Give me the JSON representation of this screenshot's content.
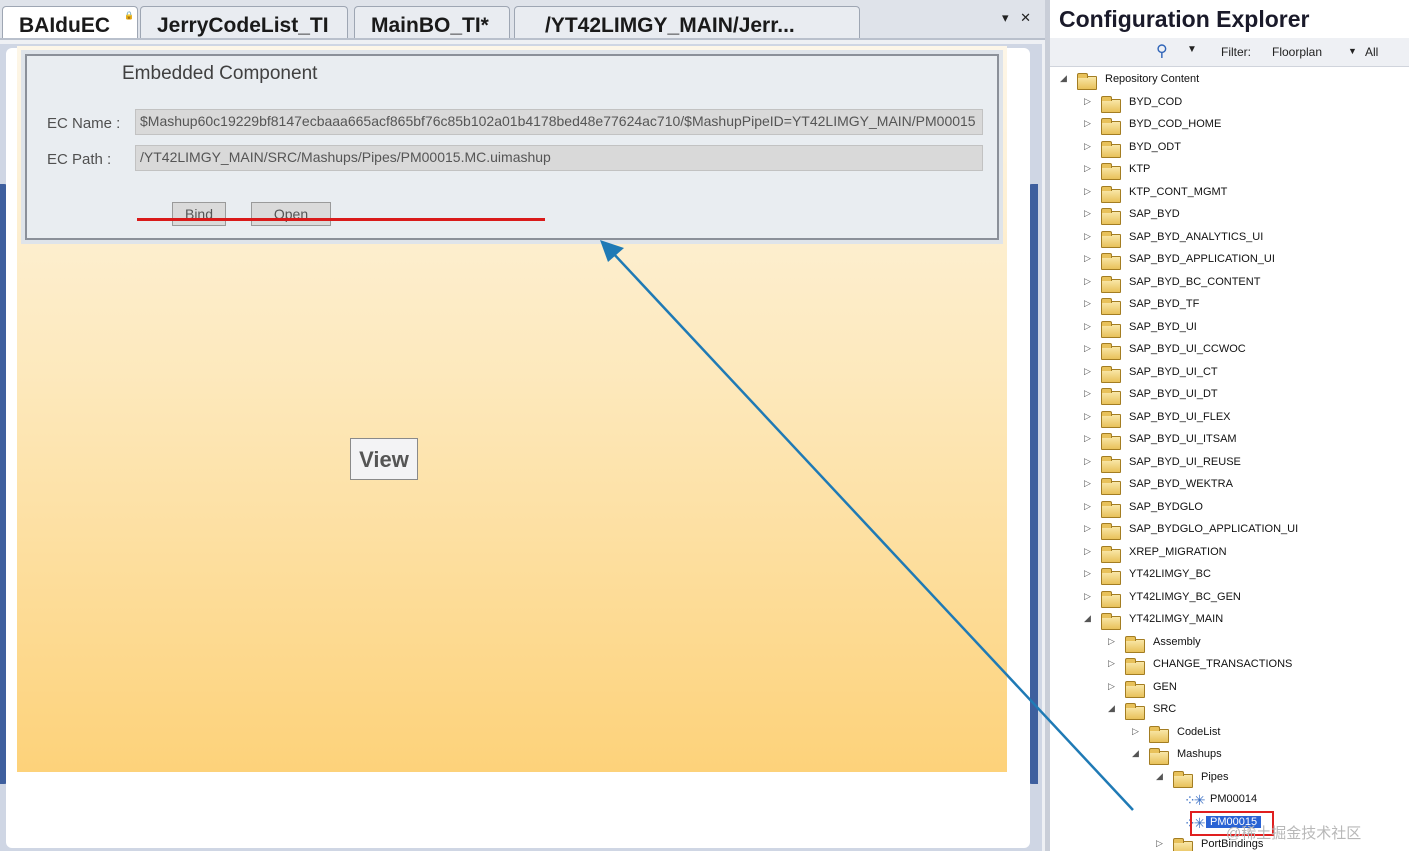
{
  "tabs": [
    {
      "label": "BAIduEC",
      "active": true,
      "locked": true
    },
    {
      "label": "JerryCodeList_TI",
      "active": false
    },
    {
      "label": "MainBO_TI*",
      "active": false
    },
    {
      "label": "/YT42LIMGY_MAIN/Jerr...",
      "active": false
    }
  ],
  "tab_controls": "▾ ✕",
  "embedded_component": {
    "title": "Embedded Component",
    "ec_name_label": "EC Name :",
    "ec_name_value": "$Mashup60c19229bf8147ecbaaa665acf865bf76c85b102a01b4178bed48e77624ac710/$MashupPipeID=YT42LIMGY_MAIN/PM00015",
    "ec_path_label": "EC Path :",
    "ec_path_value": "/YT42LIMGY_MAIN/SRC/Mashups/Pipes/PM00015.MC.uimashup",
    "bind_label": "Bind",
    "open_label": "Open"
  },
  "view_label": "View",
  "explorer": {
    "title": "Configuration Explorer",
    "filter_label": "Filter:",
    "filter_value": "Floorplan",
    "filter_all": "All",
    "tree": [
      {
        "label": "Repository Content",
        "level": 0,
        "state": "expanded",
        "icon": "folder-icon"
      },
      {
        "label": "BYD_COD",
        "level": 1,
        "state": "collapsed",
        "icon": "folder-icon"
      },
      {
        "label": "BYD_COD_HOME",
        "level": 1,
        "state": "collapsed",
        "icon": "folder-icon"
      },
      {
        "label": "BYD_ODT",
        "level": 1,
        "state": "collapsed",
        "icon": "folder-icon"
      },
      {
        "label": "KTP",
        "level": 1,
        "state": "collapsed",
        "icon": "folder-icon"
      },
      {
        "label": "KTP_CONT_MGMT",
        "level": 1,
        "state": "collapsed",
        "icon": "folder-icon"
      },
      {
        "label": "SAP_BYD",
        "level": 1,
        "state": "collapsed",
        "icon": "folder-icon"
      },
      {
        "label": "SAP_BYD_ANALYTICS_UI",
        "level": 1,
        "state": "collapsed",
        "icon": "folder-icon"
      },
      {
        "label": "SAP_BYD_APPLICATION_UI",
        "level": 1,
        "state": "collapsed",
        "icon": "folder-icon"
      },
      {
        "label": "SAP_BYD_BC_CONTENT",
        "level": 1,
        "state": "collapsed",
        "icon": "folder-icon"
      },
      {
        "label": "SAP_BYD_TF",
        "level": 1,
        "state": "collapsed",
        "icon": "folder-icon"
      },
      {
        "label": "SAP_BYD_UI",
        "level": 1,
        "state": "collapsed",
        "icon": "folder-icon"
      },
      {
        "label": "SAP_BYD_UI_CCWOC",
        "level": 1,
        "state": "collapsed",
        "icon": "folder-icon"
      },
      {
        "label": "SAP_BYD_UI_CT",
        "level": 1,
        "state": "collapsed",
        "icon": "folder-icon"
      },
      {
        "label": "SAP_BYD_UI_DT",
        "level": 1,
        "state": "collapsed",
        "icon": "folder-icon"
      },
      {
        "label": "SAP_BYD_UI_FLEX",
        "level": 1,
        "state": "collapsed",
        "icon": "folder-icon"
      },
      {
        "label": "SAP_BYD_UI_ITSAM",
        "level": 1,
        "state": "collapsed",
        "icon": "folder-icon"
      },
      {
        "label": "SAP_BYD_UI_REUSE",
        "level": 1,
        "state": "collapsed",
        "icon": "folder-icon"
      },
      {
        "label": "SAP_BYD_WEKTRA",
        "level": 1,
        "state": "collapsed",
        "icon": "folder-icon"
      },
      {
        "label": "SAP_BYDGLO",
        "level": 1,
        "state": "collapsed",
        "icon": "folder-icon"
      },
      {
        "label": "SAP_BYDGLO_APPLICATION_UI",
        "level": 1,
        "state": "collapsed",
        "icon": "folder-icon"
      },
      {
        "label": "XREP_MIGRATION",
        "level": 1,
        "state": "collapsed",
        "icon": "folder-icon"
      },
      {
        "label": "YT42LIMGY_BC",
        "level": 1,
        "state": "collapsed",
        "icon": "folder-icon"
      },
      {
        "label": "YT42LIMGY_BC_GEN",
        "level": 1,
        "state": "collapsed",
        "icon": "folder-icon"
      },
      {
        "label": "YT42LIMGY_MAIN",
        "level": 1,
        "state": "expanded",
        "icon": "folder-icon"
      },
      {
        "label": "Assembly",
        "level": 2,
        "state": "collapsed",
        "icon": "folder-icon"
      },
      {
        "label": "CHANGE_TRANSACTIONS",
        "level": 2,
        "state": "collapsed",
        "icon": "folder-icon"
      },
      {
        "label": "GEN",
        "level": 2,
        "state": "collapsed",
        "icon": "folder-icon"
      },
      {
        "label": "SRC",
        "level": 2,
        "state": "expanded",
        "icon": "folder-icon"
      },
      {
        "label": "CodeList",
        "level": 3,
        "state": "collapsed",
        "icon": "folder-icon"
      },
      {
        "label": "Mashups",
        "level": 3,
        "state": "expanded",
        "icon": "folder-icon"
      },
      {
        "label": "Pipes",
        "level": 4,
        "state": "expanded",
        "icon": "folder-icon"
      },
      {
        "label": "PM00014",
        "level": 5,
        "state": "leaf",
        "icon": "mashup-pipe-icon"
      },
      {
        "label": "PM00015",
        "level": 5,
        "state": "leaf",
        "icon": "mashup-pipe-icon",
        "selected": true
      },
      {
        "label": "PortBindings",
        "level": 4,
        "state": "collapsed",
        "icon": "folder-icon"
      }
    ]
  },
  "watermark": "@稀土掘金技术社区",
  "colors": {
    "selection": "#2a63d4",
    "annotation_arrow": "#1f7ab5",
    "annotation_highlight": "#e01f1f"
  }
}
